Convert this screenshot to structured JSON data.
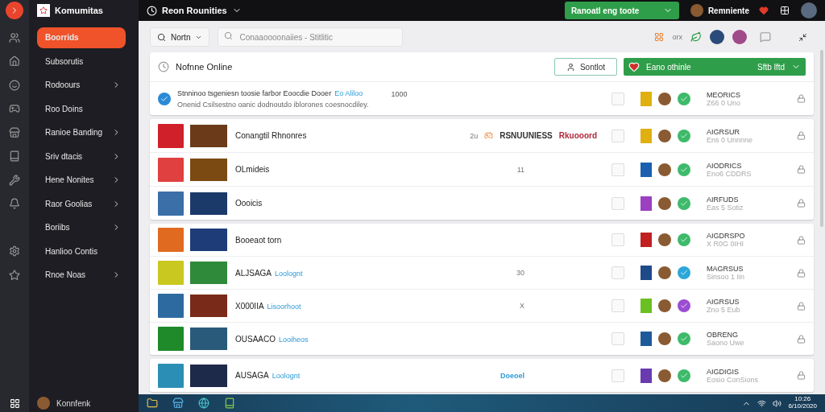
{
  "app": {
    "title": "Komumitas"
  },
  "sidebar": {
    "items": [
      {
        "label": "Boorrids",
        "selected": true,
        "chevron": false
      },
      {
        "label": "Subsorutis",
        "selected": false,
        "chevron": false
      },
      {
        "label": "Rodoours",
        "selected": false,
        "chevron": true
      },
      {
        "label": "Roo Doins",
        "selected": false,
        "chevron": false
      },
      {
        "label": "Ranioe Banding",
        "selected": false,
        "chevron": true
      },
      {
        "label": "Sriv dtacis",
        "selected": false,
        "chevron": true
      },
      {
        "label": "Hene Nonites",
        "selected": false,
        "chevron": true
      },
      {
        "label": "Raor Goolias",
        "selected": false,
        "chevron": true
      },
      {
        "label": "Boriibs",
        "selected": false,
        "chevron": true
      },
      {
        "label": "Hanlioo Contis",
        "selected": false,
        "chevron": false
      },
      {
        "label": "Rnoe Noas",
        "selected": false,
        "chevron": true
      }
    ],
    "user": "Konnfenk"
  },
  "topbar": {
    "title": "Reon Rounities",
    "status_button": "Ranoatl eng toote",
    "user": "Remniente"
  },
  "toolbar": {
    "filter": "Nortn",
    "search_placeholder": "Conaaoooonaiies - Stitlitic",
    "label": "orx"
  },
  "panel": {
    "title": "Nofnne Online",
    "button": "Sontlot",
    "status": {
      "label": "Eano othinle",
      "value": "Sftb lftd"
    },
    "notice": {
      "text": "Stnninoo tsgeniesn toosie farbor Eoocdie Dooer",
      "link": "Eo Aliloo",
      "detail": "Onenid Csilsestno oanic dodnoutdo iblorones coesnocdiley.",
      "count": "1000",
      "name": "MEORICS",
      "sub": "Z66 0 Uno",
      "color": "#3dba6a"
    }
  },
  "groups": [
    {
      "rows": [
        {
          "title": "Conangtil Rhnonres",
          "note": "2u",
          "note_link": false,
          "tags": [
            {
              "text": "RSNUUNIESS",
              "color": "#333333"
            },
            {
              "text": "Rkuooord",
              "color": "#b0283a"
            }
          ],
          "name": "AIGRSUR",
          "sub": "Ens 0 Unnnne",
          "color": "#3dba6a"
        },
        {
          "title": "OLmideis",
          "note": "11",
          "note_link": false,
          "name": "AIODRICS",
          "sub": "Eno6 CDDRS",
          "color": "#3dba6a"
        },
        {
          "title": "Oooicis",
          "name": "AIRFUDS",
          "sub": "Eas 5 Sotiz",
          "color": "#3dba6a"
        }
      ]
    },
    {
      "rows": [
        {
          "title": "Booeaot torn",
          "name": "AIGDRSPO",
          "sub": "X R0G 0IHI",
          "color": "#3dba6a"
        },
        {
          "title": "ALJSAGA",
          "link": "Loolognt",
          "note": "30",
          "note_link": false,
          "name": "MAGRSUS",
          "sub": "Sinsoo 1 Iin",
          "color": "#2ba7d9"
        },
        {
          "title": "X000IIA",
          "link": "Lisoorhoot",
          "note": "X",
          "note_link": false,
          "name": "AIGRSUS",
          "sub": "Zno 5 Eub",
          "color": "#9b4dd1"
        },
        {
          "title": "OUSAACO",
          "link": "Looiheos",
          "name": "OBRENG",
          "sub": "Saono Uwe",
          "color": "#3dba6a"
        }
      ]
    },
    {
      "rows": [
        {
          "title": "AUSAGA",
          "link": "Loolognt",
          "note": "Doeoel",
          "note_link": true,
          "name": "AIGDIGIS",
          "sub": "Eosio ConSions",
          "color": "#3dba6a"
        }
      ]
    }
  ],
  "taskbar": {
    "time": "10:26",
    "date": "6/10/2020"
  }
}
